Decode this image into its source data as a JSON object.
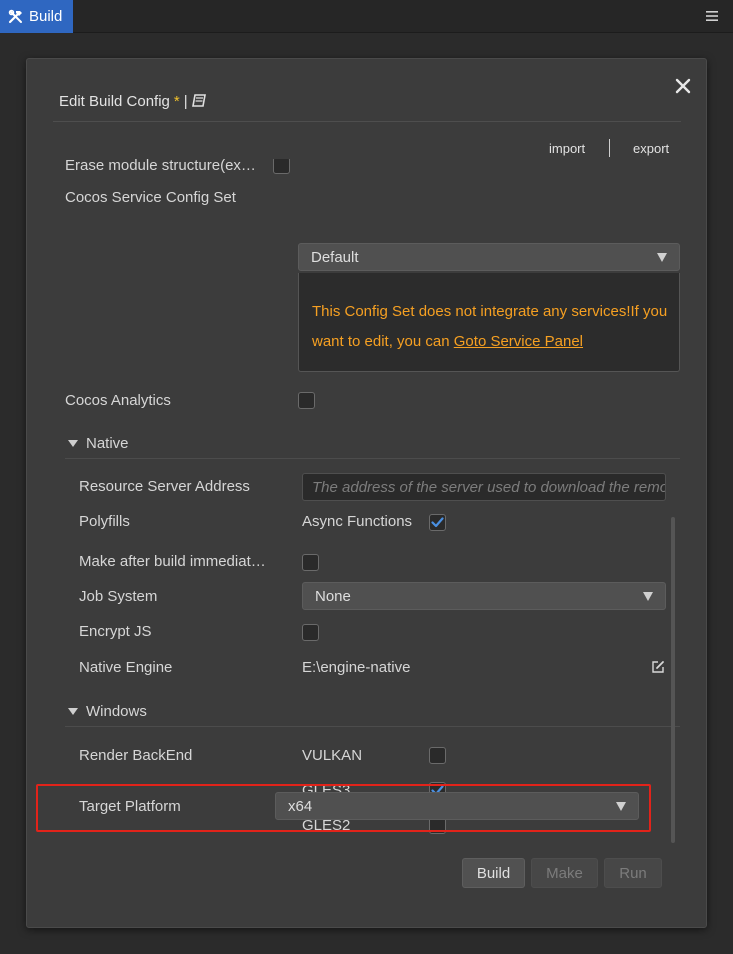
{
  "window": {
    "tab_label": "Build",
    "menu_icon": "menu-lines-icon"
  },
  "dialog": {
    "title": "Edit Build Config",
    "modified_marker": "*",
    "title_separator": "|",
    "import_label": "import",
    "export_label": "export",
    "separator": "|"
  },
  "general": {
    "erase_label": "Erase module structure(ex…",
    "service_config_label": "Cocos Service Config Set",
    "service_config_value": "Default",
    "service_info_text": "This Config Set does not integrate any services!If you want to edit, you can ",
    "service_info_link": "Goto Service Panel",
    "analytics_label": "Cocos Analytics"
  },
  "native": {
    "section_label": "Native",
    "server_label": "Resource Server Address",
    "server_placeholder": "The address of the server used to download the remote resources",
    "polyfills_label": "Polyfills",
    "polyfills_option": "Async Functions",
    "make_after_label": "Make after build immediat…",
    "job_system_label": "Job System",
    "job_system_value": "None",
    "encrypt_label": "Encrypt JS",
    "engine_label": "Native Engine",
    "engine_value": "E:\\engine-native"
  },
  "windows": {
    "section_label": "Windows",
    "render_label": "Render BackEnd",
    "backends": [
      {
        "name": "VULKAN",
        "checked": false
      },
      {
        "name": "GLES3",
        "checked": true
      },
      {
        "name": "GLES2",
        "checked": false
      }
    ],
    "target_label": "Target Platform",
    "target_value": "x64"
  },
  "actions": {
    "build_label": "Build",
    "make_label": "Make",
    "run_label": "Run"
  },
  "colors": {
    "accent": "#2f67c1",
    "warning_text": "#f6a022",
    "highlight_border": "#e2231a",
    "check_color": "#4a90e2"
  }
}
